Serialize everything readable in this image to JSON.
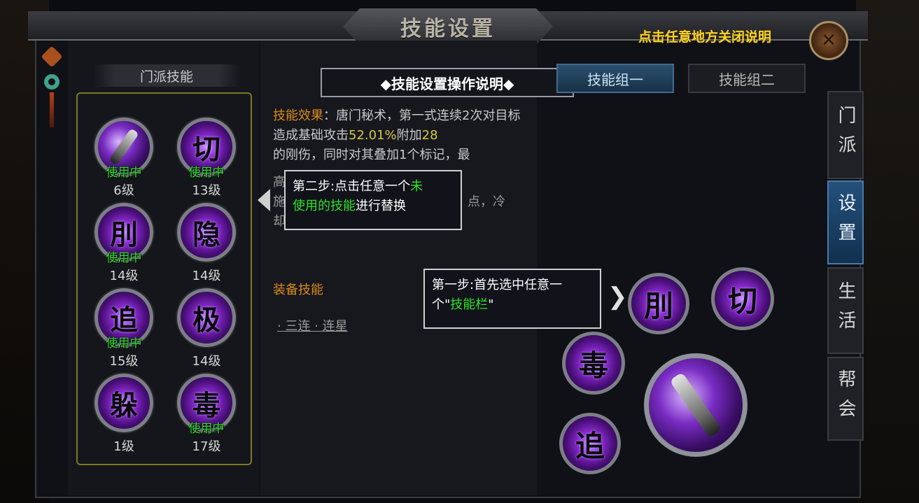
{
  "window": {
    "title": "技能设置",
    "close_hint": "点击任意地方关闭说明",
    "close_icon": "x-icon"
  },
  "left": {
    "header": "门派技能",
    "skills": [
      {
        "glyph": "",
        "status": "使用中",
        "level": "6级",
        "icon": "sword-art-icon"
      },
      {
        "glyph": "切",
        "status": "使用中",
        "level": "13级"
      },
      {
        "glyph": "刖",
        "status": "使用中",
        "level": "14级"
      },
      {
        "glyph": "隐",
        "status": "",
        "level": "14级"
      },
      {
        "glyph": "追",
        "status": "使用中",
        "level": "15级"
      },
      {
        "glyph": "极",
        "status": "",
        "level": "14级"
      },
      {
        "glyph": "躲",
        "status": "",
        "level": "1级"
      },
      {
        "glyph": "毒",
        "status": "使用中",
        "level": "17级"
      }
    ]
  },
  "middle": {
    "instructions_title": "◆技能设置操作说明◆",
    "effect_label": "技能效果",
    "effect_sep": "：",
    "effect_text_1": "唐门秘术，第一式连续2次对目标造成基础攻击",
    "effect_pct": "52.01%",
    "effect_text_2": "附加",
    "effect_num": "28",
    "effect_text_3": "的刚伤，同时对其叠加1个标记，最",
    "frag_1": "高",
    "frag_2": "施",
    "frag_3": "点，冷",
    "frag_4": "却",
    "equip_header": "装备技能",
    "equip_item": "· 三连 · 连星"
  },
  "tips": {
    "step2_a": "第二步:点击任意一个",
    "step2_hl1": "未",
    "step2_hl2": "使用的技能",
    "step2_b": "进行替换",
    "step1_a": "第一步:首先选中任意一个\"",
    "step1_hl": "技能栏",
    "step1_b": "\""
  },
  "right": {
    "tab_group1": "技能组一",
    "tab_group2": "技能组二",
    "bar_glyphs": {
      "a": "刖",
      "b": "切",
      "c": "毒",
      "d": "追"
    },
    "big_skill_icon": "sword-art-icon"
  },
  "side_tabs": [
    {
      "label": "门派",
      "active": false
    },
    {
      "label": "设置",
      "active": true
    },
    {
      "label": "生活",
      "active": false
    },
    {
      "label": "帮会",
      "active": false
    }
  ],
  "colors": {
    "accent_green": "#2ee02a",
    "accent_orange": "#d98a1c",
    "accent_yellow": "#ffd21e",
    "active_tab": "#24507a"
  }
}
